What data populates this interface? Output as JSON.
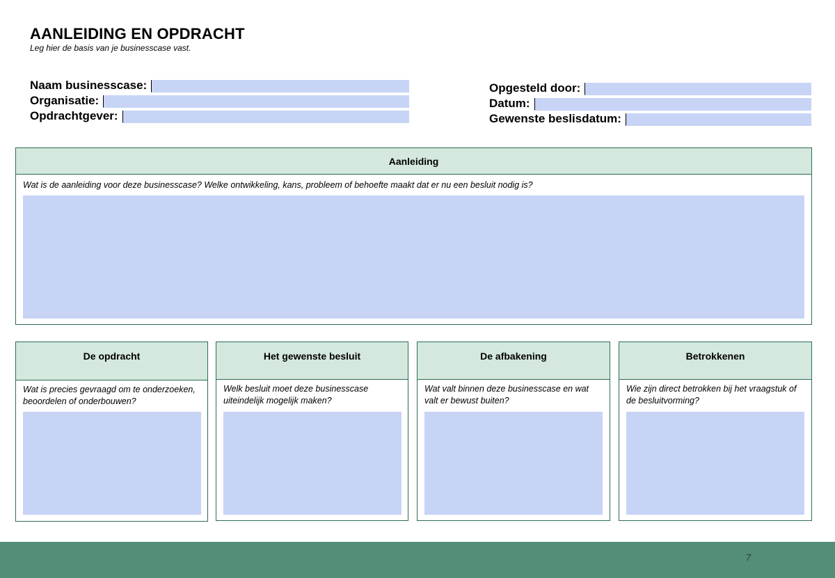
{
  "page": {
    "title": "AANLEIDING EN OPDRACHT",
    "subtitle": "Leg hier de basis van je businesscase vast."
  },
  "fields_left": [
    {
      "label": "Naam businesscase:",
      "value": ""
    },
    {
      "label": "Organisatie:",
      "value": ""
    },
    {
      "label": "Opdrachtgever:",
      "value": ""
    }
  ],
  "fields_right": [
    {
      "label": "Opgesteld door:",
      "value": ""
    },
    {
      "label": "Datum:",
      "value": ""
    },
    {
      "label": "Gewenste beslisdatum:",
      "value": ""
    }
  ],
  "aanleiding": {
    "header": "Aanleiding",
    "question": "Wat is de aanleiding voor deze businesscase? Welke ontwikkeling, kans, probleem of behoefte maakt dat er nu een besluit nodig is?",
    "answer": ""
  },
  "boxes": [
    {
      "header": "De opdracht",
      "question": "Wat is precies gevraagd om te onderzoeken, beoordelen of onderbouwen?",
      "answer": ""
    },
    {
      "header": "Het gewenste besluit",
      "question": "Welk besluit moet deze businesscase uiteindelijk mogelijk maken?",
      "answer": ""
    },
    {
      "header": "De afbakening",
      "question": "Wat valt binnen deze businesscase en wat valt er bewust buiten?",
      "answer": ""
    },
    {
      "header": "Betrokkenen",
      "question": "Wie zijn direct betrokken bij het vraagstuk of de besluitvorming?",
      "answer": ""
    }
  ],
  "footer": {
    "page_number": "7"
  },
  "colors": {
    "header_fill": "#d4e8de",
    "border": "#2e6b55",
    "input_fill": "#c7d4f6",
    "footer_bar": "#538e79"
  }
}
